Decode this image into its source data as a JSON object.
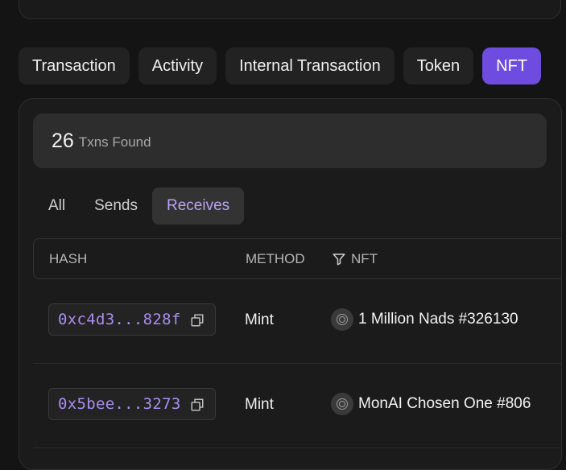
{
  "tabs": [
    {
      "label": "Transaction",
      "active": false
    },
    {
      "label": "Activity",
      "active": false
    },
    {
      "label": "Internal Transaction",
      "active": false
    },
    {
      "label": "Token",
      "active": false
    },
    {
      "label": "NFT",
      "active": true
    }
  ],
  "summary": {
    "count": "26",
    "suffix": "Txns Found"
  },
  "filters": [
    {
      "label": "All",
      "active": false
    },
    {
      "label": "Sends",
      "active": false
    },
    {
      "label": "Receives",
      "active": true
    }
  ],
  "table": {
    "headers": {
      "hash": "HASH",
      "method": "METHOD",
      "nft": "NFT"
    },
    "rows": [
      {
        "hash": "0xc4d3...828f",
        "method": "Mint",
        "nft": "1 Million Nads #326130"
      },
      {
        "hash": "0x5bee...3273",
        "method": "Mint",
        "nft": "MonAI Chosen One #806"
      }
    ]
  },
  "colors": {
    "accent": "#6e4ce0",
    "hash_text": "#a88ff0",
    "active_filter_text": "#b9a3f5"
  }
}
